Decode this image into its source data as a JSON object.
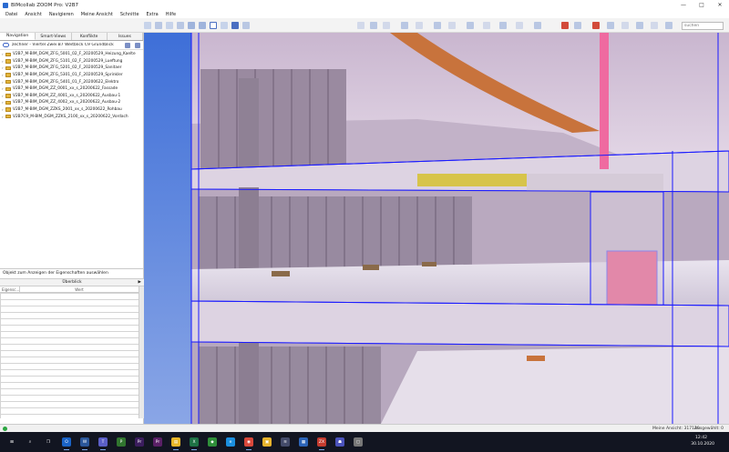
{
  "window": {
    "title": "BIMcollab ZOOM Pro: V2B7",
    "controls": [
      "—",
      "□",
      "✕"
    ]
  },
  "menu": [
    "Datei",
    "Ansicht",
    "Navigieren",
    "Meine Ansicht",
    "Schnitte",
    "Extra",
    "Hilfe"
  ],
  "toolbar": {
    "search_placeholder": "suchen"
  },
  "left_panel": {
    "tabs": [
      {
        "label": "Navigation",
        "active": true
      },
      {
        "label": "Smart-Views",
        "active": false
      },
      {
        "label": "Konflikte",
        "active": false
      },
      {
        "label": "Issues",
        "active": false
      }
    ],
    "project_label": "zechner - Viertel Zwei B7 Weitblick C9 Grundblick",
    "tree": [
      "V2B7_M-BIM_DGM_ZFG_5001_02_F_20200529_Heizung_Kaelte",
      "V2B7_M-BIM_DGM_ZFG_5101_02_F_20200529_Lueftung",
      "V2B7_M-BIM_DGM_ZFG_5201_02_F_20200529_Sanitaer",
      "V2B7_M-BIM_DGM_ZFG_5301_01_F_20200529_Sprinkler",
      "V2B7_M-BIM_DGM_ZFG_5401_01_F_20200622_Elektro",
      "V2B7_M-BIM_DGM_ZZ_0001_xx_s_20200622_Fassade",
      "V2B7_M-BIM_DGM_ZZ_4001_xx_s_20200622_Ausbau-1",
      "V2B7_M-BIM_DGM_ZZ_4002_xx_s_20200622_Ausbau-2",
      "V2B7_M-BIM_DGM_ZZKS_2001_xx_s_20200622_Rohbau",
      "V2B7C9_M-BIM_DGM_ZZKS_2100_xx_s_20200622_Vordach"
    ],
    "properties_title": "Objekt zum Anzeigen der Eigenschaften auswählen",
    "overview_label": "Überblick",
    "overview_arrow": "▶",
    "col_property": "Eigensc...",
    "col_value": "Wert"
  },
  "status": {
    "view_info": "Meine Ansicht: 317129",
    "selected": "Ausgewählt: 0"
  },
  "taskbar": {
    "time": "12:42",
    "date": "30.10.2020",
    "apps": [
      {
        "name": "windows-start-icon",
        "glyph": "⊞",
        "color": "#ffffff"
      },
      {
        "name": "search-icon",
        "glyph": "⌕",
        "color": "#ffffff"
      },
      {
        "name": "task-view-icon",
        "glyph": "❐",
        "color": "#ffffff"
      },
      {
        "name": "outlook-icon",
        "glyph": "O",
        "color": "#1a63c7"
      },
      {
        "name": "word-icon",
        "glyph": "W",
        "color": "#2b579a"
      },
      {
        "name": "teams-icon",
        "glyph": "T",
        "color": "#5b5fc7"
      },
      {
        "name": "project-icon",
        "glyph": "P",
        "color": "#31752f"
      },
      {
        "name": "premiere-icon",
        "glyph": "Pr",
        "color": "#3b1d5e"
      },
      {
        "name": "premiere-rush-icon",
        "glyph": "Pr",
        "color": "#5a2066"
      },
      {
        "name": "file-explorer-icon",
        "glyph": "▤",
        "color": "#e8b629"
      },
      {
        "name": "excel-icon",
        "glyph": "X",
        "color": "#1e7145"
      },
      {
        "name": "app-green-icon",
        "glyph": "◆",
        "color": "#2f8f3a"
      },
      {
        "name": "edge-icon",
        "glyph": "e",
        "color": "#1b8fe0"
      },
      {
        "name": "chrome-icon",
        "glyph": "◉",
        "color": "#d9483b"
      },
      {
        "name": "app-yellow-icon",
        "glyph": "▣",
        "color": "#e6b22c"
      },
      {
        "name": "wifi-icon",
        "glyph": "≋",
        "color": "#444b6a"
      },
      {
        "name": "app-blue-icon",
        "glyph": "▦",
        "color": "#2c64b8"
      },
      {
        "name": "bimcollab-zoom-icon",
        "glyph": "ZX",
        "color": "#c43b2f"
      },
      {
        "name": "app-teams-icon",
        "glyph": "☗",
        "color": "#4b53bc"
      },
      {
        "name": "app-gray-icon",
        "glyph": "▢",
        "color": "#777777"
      }
    ]
  }
}
